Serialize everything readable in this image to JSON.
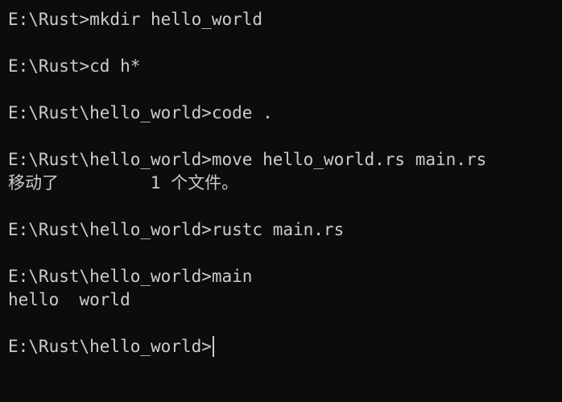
{
  "terminal": {
    "lines": [
      "E:\\Rust>mkdir hello_world",
      "E:\\Rust>cd h*",
      "E:\\Rust\\hello_world>code .",
      "E:\\Rust\\hello_world>move hello_world.rs main.rs",
      "移动了         1 个文件。",
      "E:\\Rust\\hello_world>rustc main.rs",
      "E:\\Rust\\hello_world>main",
      "hello  world",
      "E:\\Rust\\hello_world>"
    ]
  },
  "colors": {
    "background": "#0c0c0c",
    "foreground": "#cccccc"
  }
}
